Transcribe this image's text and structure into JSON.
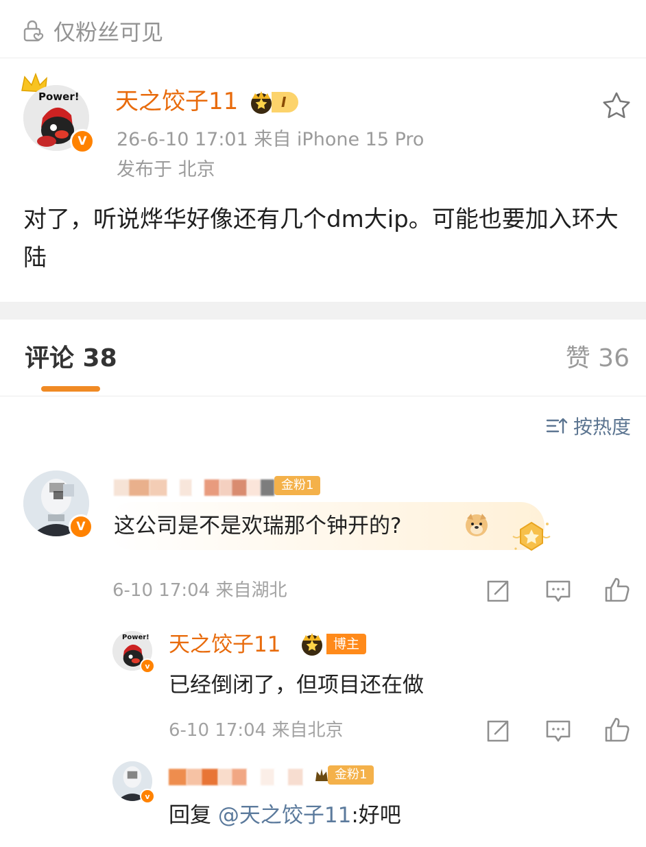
{
  "post": {
    "visibility_label": "仅粉丝可见",
    "author": {
      "name": "天之饺子11",
      "avatar_caption": "Power!",
      "verified_mark": "V",
      "level_label": "I"
    },
    "meta_line1": "26-6-10 17:01  来自 iPhone 15 Pro",
    "meta_line2": "发布于 北京",
    "text": "对了，听说烨华好像还有几个dm大ip。可能也要加入环大陆"
  },
  "tabs": {
    "comments_label": "评论 38",
    "likes_label": "赞 36"
  },
  "sort_label": "按热度",
  "comments": [
    {
      "fan_badge": "金粉1",
      "verified_mark": "V",
      "text": "这公司是不是欢瑞那个钟开的?",
      "meta": "6-10 17:04  来自湖北",
      "replies": [
        {
          "name": "天之饺子11",
          "role_badge": "博主",
          "avatar_caption": "Power!",
          "verified_mark": "v",
          "text": "已经倒闭了，但项目还在做",
          "meta": "6-10 17:04  来自北京"
        },
        {
          "fan_badge": "金粉1",
          "verified_mark": "v",
          "reply_prefix": "回复 ",
          "mention": "@天之饺子11",
          "text": ":好吧"
        }
      ]
    }
  ],
  "icons": {
    "lock_heart": "lock-heart-icon",
    "star": "star-icon",
    "sort": "sort-icon",
    "share": "share-icon",
    "comment": "comment-icon",
    "like": "like-icon"
  },
  "colors": {
    "author_name": "#e86b0c",
    "accent_underline": "#f08a24",
    "verified": "#ff8200",
    "fan_badge": "#f4b14a",
    "blogger_badge": "#ff8a1a",
    "link": "#5b7a9c",
    "meta_gray": "#9b9b9b"
  }
}
